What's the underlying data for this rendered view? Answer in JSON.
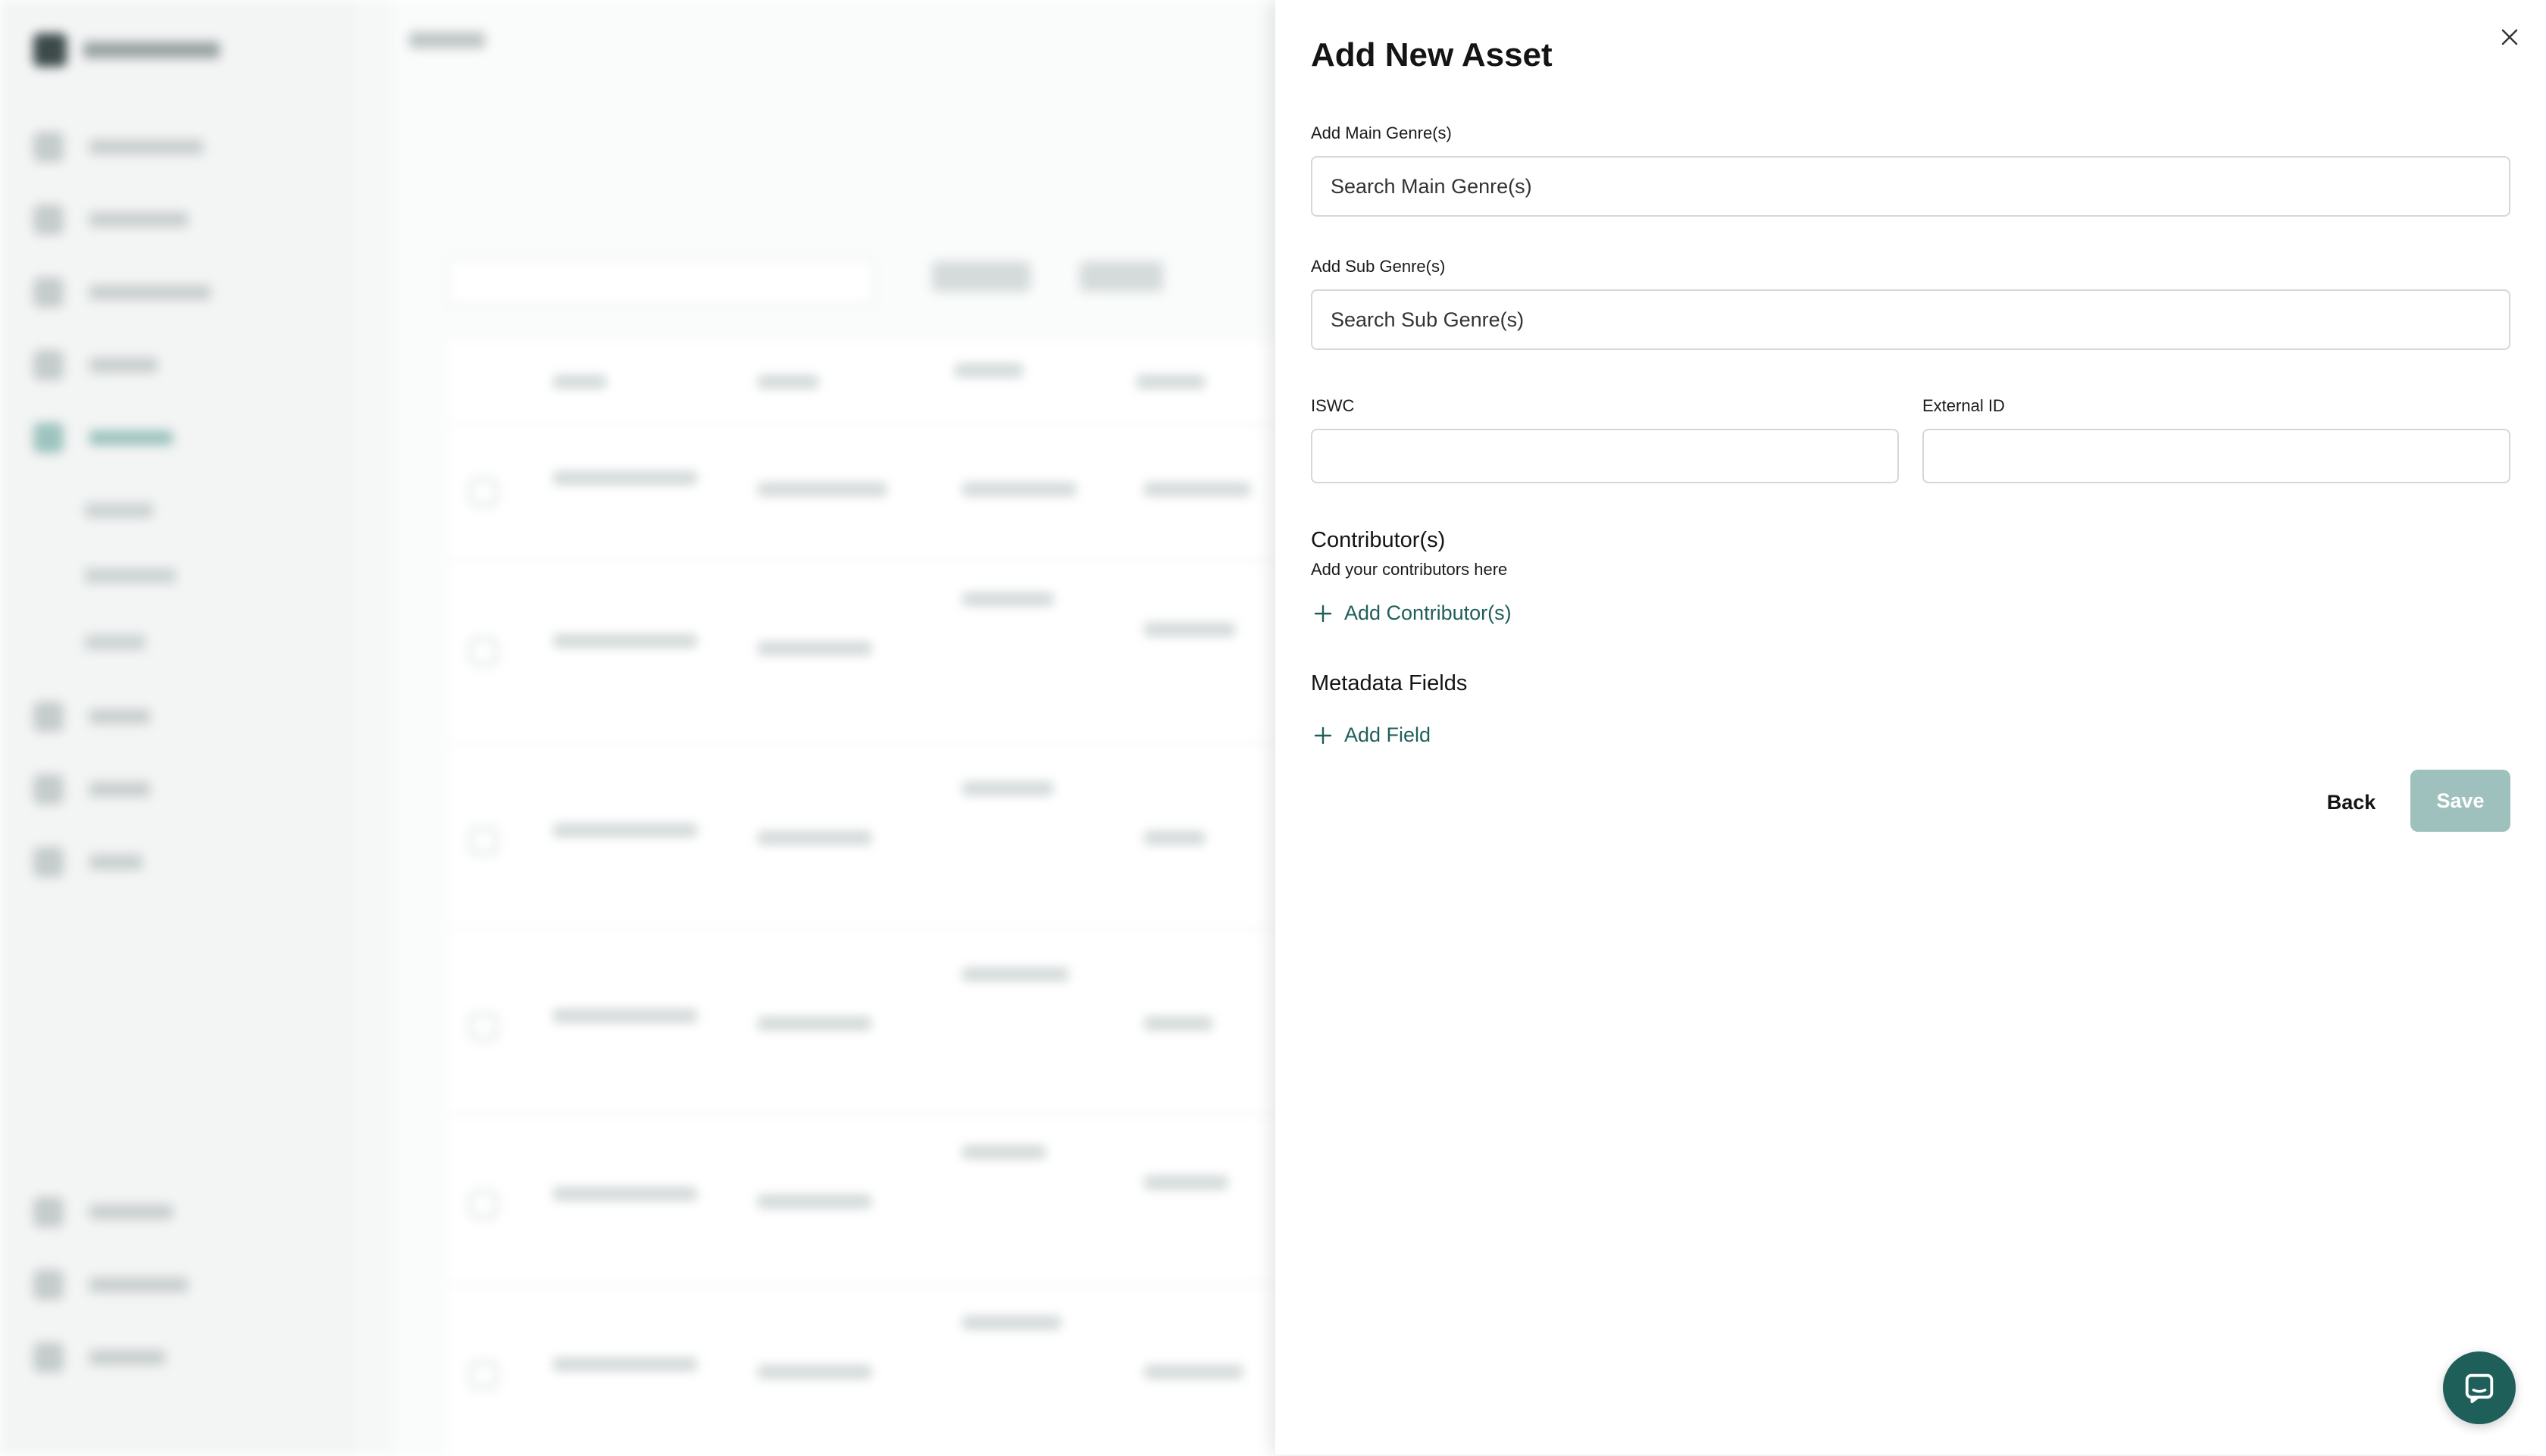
{
  "panel": {
    "title": "Add New Asset",
    "main_genre": {
      "label": "Add Main Genre(s)",
      "placeholder": "Search Main Genre(s)",
      "value": ""
    },
    "sub_genre": {
      "label": "Add Sub Genre(s)",
      "placeholder": "Search Sub Genre(s)",
      "value": ""
    },
    "iswc": {
      "label": "ISWC",
      "value": ""
    },
    "external_id": {
      "label": "External ID",
      "value": ""
    },
    "contributors": {
      "title": "Contributor(s)",
      "subtitle": "Add your contributors here",
      "add_label": "Add Contributor(s)"
    },
    "metadata": {
      "title": "Metadata Fields",
      "add_label": "Add Field"
    },
    "buttons": {
      "back": "Back",
      "save": "Save"
    }
  },
  "icons": {
    "close": "close-icon",
    "add": "plus-icon",
    "chat": "chat-icon"
  },
  "colors": {
    "accent": "#1f5f5a",
    "save_disabled": "#9fc1bd",
    "input_border": "#d5d8d8"
  }
}
